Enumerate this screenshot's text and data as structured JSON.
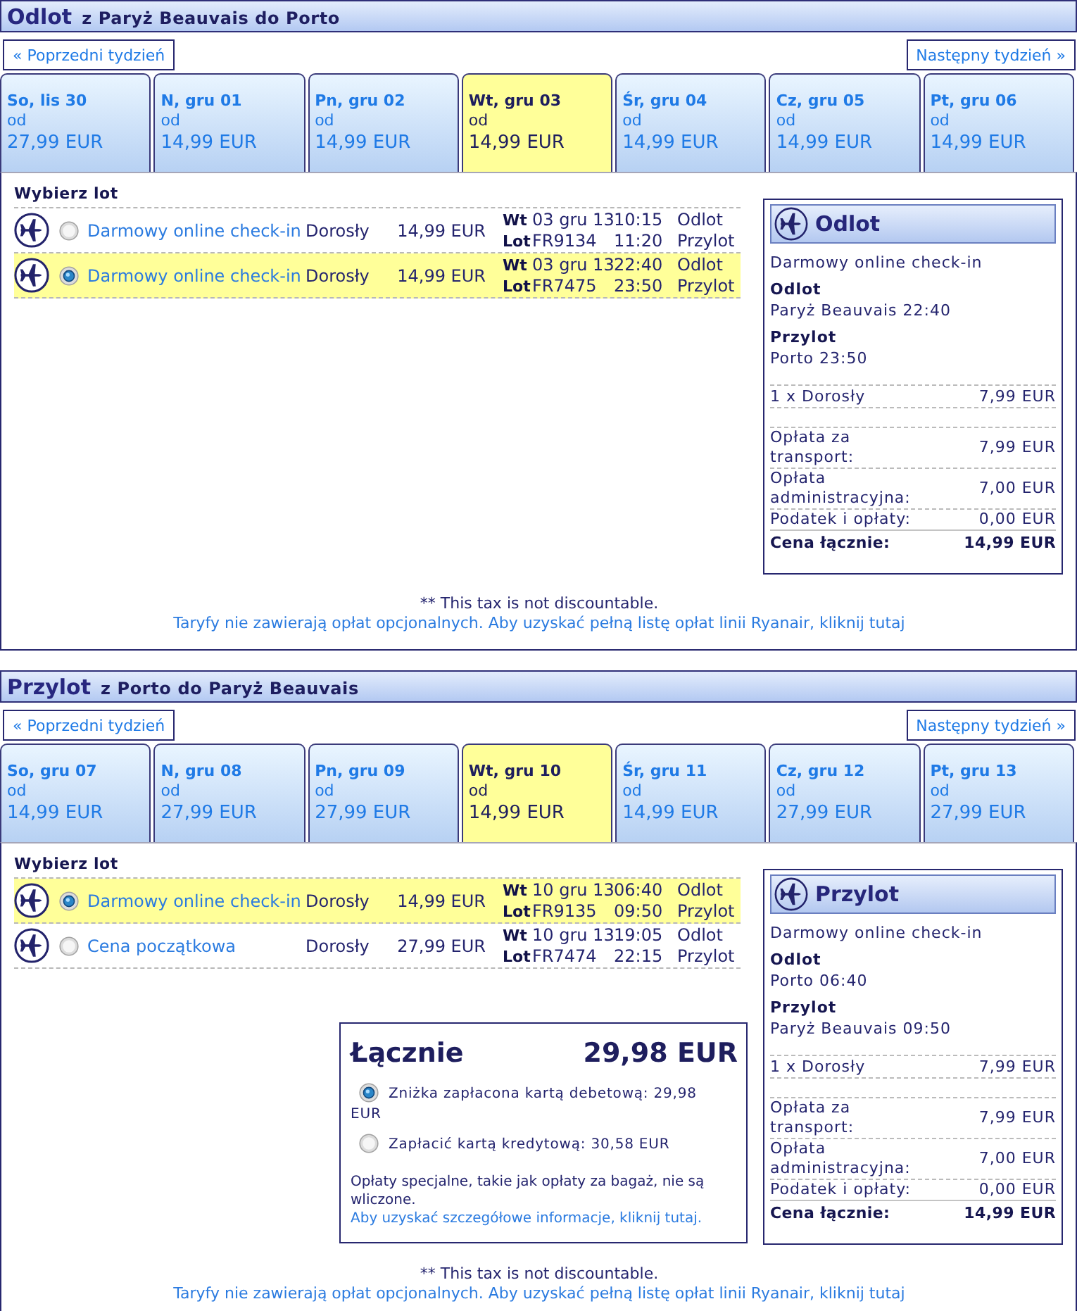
{
  "sections": [
    {
      "title": "Odlot",
      "route": "z Paryż Beauvais do Porto",
      "prev_week": "« Poprzedni tydzień",
      "next_week": "Następny tydzień »",
      "days": [
        {
          "day": "So, lis 30",
          "from": "od",
          "price": "27,99 EUR",
          "selected": false
        },
        {
          "day": "N, gru 01",
          "from": "od",
          "price": "14,99 EUR",
          "selected": false
        },
        {
          "day": "Pn, gru 02",
          "from": "od",
          "price": "14,99 EUR",
          "selected": false
        },
        {
          "day": "Wt, gru 03",
          "from": "od",
          "price": "14,99 EUR",
          "selected": true
        },
        {
          "day": "Śr, gru 04",
          "from": "od",
          "price": "14,99 EUR",
          "selected": false
        },
        {
          "day": "Cz, gru 05",
          "from": "od",
          "price": "14,99 EUR",
          "selected": false
        },
        {
          "day": "Pt, gru 06",
          "from": "od",
          "price": "14,99 EUR",
          "selected": false
        }
      ],
      "flights_heading": "Wybierz lot",
      "flights": [
        {
          "fare": "Darmowy online check-in",
          "passenger": "Dorosły",
          "price": "14,99 EUR",
          "day": "Wt",
          "date": "03 gru 13",
          "departure_time": "10:15",
          "departure_label": "Odlot",
          "flight_label": "Lot",
          "flight_number": "FR9134",
          "arrival_time": "11:20",
          "arrival_label": "Przylot",
          "selected": false
        },
        {
          "fare": "Darmowy online check-in",
          "passenger": "Dorosły",
          "price": "14,99 EUR",
          "day": "Wt",
          "date": "03 gru 13",
          "departure_time": "22:40",
          "departure_label": "Odlot",
          "flight_label": "Lot",
          "flight_number": "FR7475",
          "arrival_time": "23:50",
          "arrival_label": "Przylot",
          "selected": true
        }
      ],
      "summary": {
        "title": "Odlot",
        "fare": "Darmowy online check-in",
        "departure_heading": "Odlot",
        "departure": "Paryż Beauvais 22:40",
        "arrival_heading": "Przylot",
        "arrival": "Porto 23:50",
        "passengers": [
          {
            "label": "1 x Dorosły",
            "amount": "7,99 EUR"
          }
        ],
        "fees": [
          {
            "label": "Opłata za transport:",
            "amount": "7,99 EUR"
          },
          {
            "label": "Opłata administracyjna:",
            "amount": "7,00 EUR"
          },
          {
            "label": "Podatek i opłaty:",
            "amount": "0,00 EUR"
          }
        ],
        "total_label": "Cena łącznie:",
        "total": "14,99 EUR"
      },
      "footnote": "** This tax is not discountable.",
      "fees_link": "Taryfy nie zawierają opłat opcjonalnych. Aby uzyskać pełną listę opłat linii Ryanair, kliknij tutaj"
    },
    {
      "title": "Przylot",
      "route": "z Porto do Paryż Beauvais",
      "prev_week": "« Poprzedni tydzień",
      "next_week": "Następny tydzień »",
      "days": [
        {
          "day": "So, gru 07",
          "from": "od",
          "price": "14,99 EUR",
          "selected": false
        },
        {
          "day": "N, gru 08",
          "from": "od",
          "price": "27,99 EUR",
          "selected": false
        },
        {
          "day": "Pn, gru 09",
          "from": "od",
          "price": "27,99 EUR",
          "selected": false
        },
        {
          "day": "Wt, gru 10",
          "from": "od",
          "price": "14,99 EUR",
          "selected": true
        },
        {
          "day": "Śr, gru 11",
          "from": "od",
          "price": "14,99 EUR",
          "selected": false
        },
        {
          "day": "Cz, gru 12",
          "from": "od",
          "price": "27,99 EUR",
          "selected": false
        },
        {
          "day": "Pt, gru 13",
          "from": "od",
          "price": "27,99 EUR",
          "selected": false
        }
      ],
      "flights_heading": "Wybierz lot",
      "flights": [
        {
          "fare": "Darmowy online check-in",
          "passenger": "Dorosły",
          "price": "14,99 EUR",
          "day": "Wt",
          "date": "10 gru 13",
          "departure_time": "06:40",
          "departure_label": "Odlot",
          "flight_label": "Lot",
          "flight_number": "FR9135",
          "arrival_time": "09:50",
          "arrival_label": "Przylot",
          "selected": true
        },
        {
          "fare": "Cena początkowa",
          "passenger": "Dorosły",
          "price": "27,99 EUR",
          "day": "Wt",
          "date": "10 gru 13",
          "departure_time": "19:05",
          "departure_label": "Odlot",
          "flight_label": "Lot",
          "flight_number": "FR7474",
          "arrival_time": "22:15",
          "arrival_label": "Przylot",
          "selected": false
        }
      ],
      "total_box": {
        "label": "Łącznie",
        "amount": "29,98 EUR",
        "payment_options": [
          {
            "label": "Zniżka zapłacona kartą debetową: 29,98 EUR",
            "selected": true
          },
          {
            "label": "Zapłacić kartą kredytową: 30,58 EUR",
            "selected": false
          }
        ],
        "note": "Opłaty specjalne, takie jak opłaty za bagaż, nie są wliczone.",
        "note_link": "Aby uzyskać szczegółowe informacje, kliknij tutaj."
      },
      "summary": {
        "title": "Przylot",
        "fare": "Darmowy online check-in",
        "departure_heading": "Odlot",
        "departure": "Porto 06:40",
        "arrival_heading": "Przylot",
        "arrival": "Paryż Beauvais 09:50",
        "passengers": [
          {
            "label": "1 x Dorosły",
            "amount": "7,99 EUR"
          }
        ],
        "fees": [
          {
            "label": "Opłata za transport:",
            "amount": "7,99 EUR"
          },
          {
            "label": "Opłata administracyjna:",
            "amount": "7,00 EUR"
          },
          {
            "label": "Podatek i opłaty:",
            "amount": "0,00 EUR"
          }
        ],
        "total_label": "Cena łącznie:",
        "total": "14,99 EUR"
      },
      "footnote": "** This tax is not discountable.",
      "fees_link": "Taryfy nie zawierają opłat opcjonalnych. Aby uzyskać pełną listę opłat linii Ryanair, kliknij tutaj"
    }
  ]
}
